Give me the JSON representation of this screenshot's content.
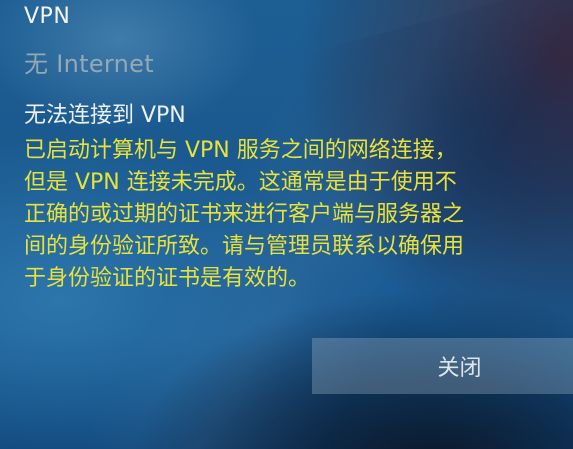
{
  "connection": {
    "name": "VPN",
    "status": "无 Internet"
  },
  "error": {
    "heading": "无法连接到 VPN",
    "message_lines": [
      "已启动计算机与 VPN 服务之间的网络连接，",
      "但是 VPN 连接未完成。这通常是由于使用不",
      "正确的或过期的证书来进行客户端与服务器之",
      "间的身份验证所致。请与管理员联系以确保用",
      "于身份验证的证书是有效的。"
    ]
  },
  "actions": {
    "close_label": "关闭"
  },
  "colors": {
    "message_text": "#e8e23a",
    "background": "#1b5a8f"
  }
}
